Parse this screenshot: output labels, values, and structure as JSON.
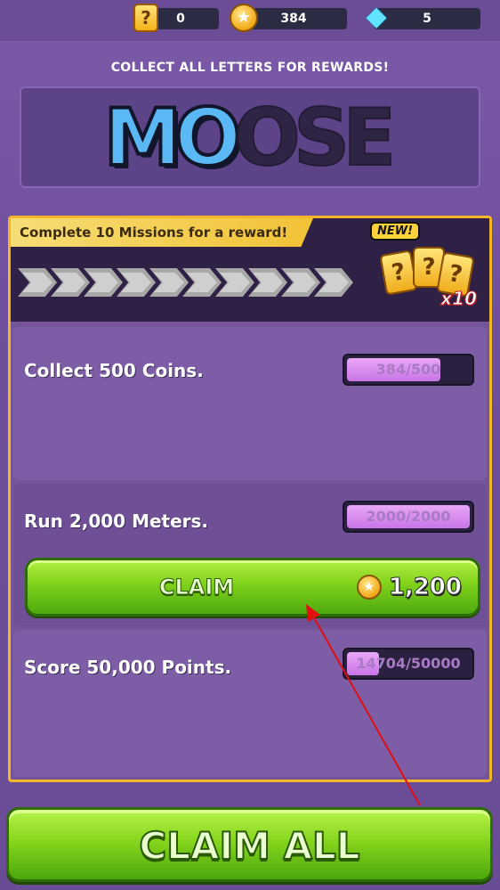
{
  "currency": {
    "mystery_boxes": "0",
    "coins": "384",
    "gems": "5"
  },
  "letters": {
    "title": "COLLECT ALL LETTERS FOR REWARDS!",
    "items": [
      {
        "char": "M",
        "collected": true
      },
      {
        "char": "O",
        "collected": true
      },
      {
        "char": "O",
        "collected": false
      },
      {
        "char": "S",
        "collected": false
      },
      {
        "char": "E",
        "collected": false
      }
    ]
  },
  "missions": {
    "banner": "Complete 10 Missions for a reward!",
    "progress_segments_total": 10,
    "progress_segments_done": 0,
    "reward": {
      "badge": "NEW!",
      "multiplier": "x10"
    },
    "list": [
      {
        "text": "Collect 500 Coins.",
        "progress_text": "384/500",
        "progress": 0.768
      },
      {
        "text": "Run 2,000 Meters.",
        "progress_text": "2000/2000",
        "progress": 1.0,
        "claim": {
          "label": "CLAIM",
          "amount": "1,200"
        }
      },
      {
        "text": "Score 50,000 Points.",
        "progress_text": "14704/50000",
        "progress": 0.294
      }
    ]
  },
  "claim_all": {
    "label": "CLAIM ALL"
  },
  "colors": {
    "accent_green": "#7fd11a",
    "panel_border": "#f3b62b",
    "letter_active": "#5ab8f4",
    "annotation_arrow": "#e01010"
  }
}
